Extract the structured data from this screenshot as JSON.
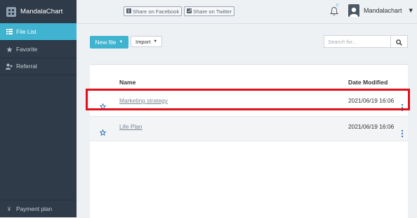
{
  "app": {
    "name": "MandalaChart"
  },
  "sidebar": {
    "items": [
      {
        "label": "File List",
        "icon": "list-icon",
        "active": true
      },
      {
        "label": "Favorite",
        "icon": "star-icon",
        "active": false
      },
      {
        "label": "Referral",
        "icon": "user-plus-icon",
        "active": false
      }
    ],
    "footer": {
      "label": "Payment plan",
      "icon": "yen-icon"
    }
  },
  "topbar": {
    "share_facebook": "Share on Facebook",
    "share_twitter": "Share on Twitter",
    "notification_count": "0",
    "username": "Mandalachart"
  },
  "toolbar": {
    "new_file_label": "New file",
    "import_label": "Import",
    "search_placeholder": "Search for..."
  },
  "table": {
    "columns": {
      "name": "Name",
      "date_modified": "Date Modified"
    },
    "rows": [
      {
        "name": "Marketing strategy",
        "date": "2021/06/19 16:06",
        "highlighted": true
      },
      {
        "name": "Life Plan",
        "date": "2021/06/19 16:06",
        "highlighted": false
      }
    ]
  },
  "colors": {
    "accent": "#3fb3cf",
    "sidebar_bg": "#2f3b48",
    "highlight": "#e1111b"
  }
}
